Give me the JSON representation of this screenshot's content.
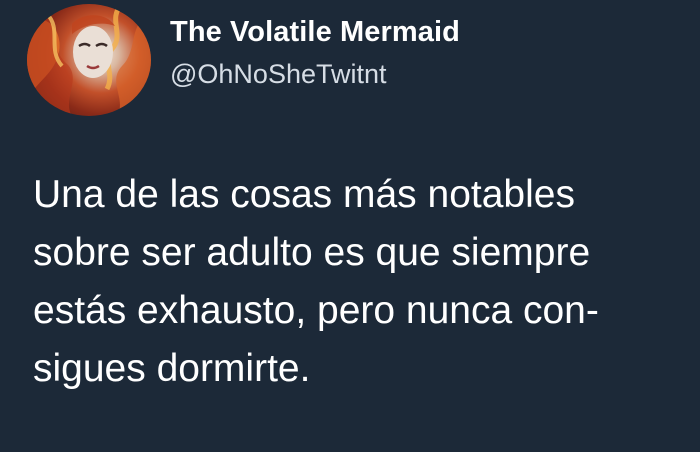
{
  "tweet": {
    "author": {
      "display_name": "The Volatile Mermaid",
      "handle": "@OhNoSheTwitnt"
    },
    "text_lines": [
      "Una de las cosas más notables",
      "sobre ser adulto es que siempre",
      "estás exhausto, pero nunca con-",
      "sigues dormirte."
    ]
  },
  "colors": {
    "background": "#1c2938",
    "text": "#ffffff",
    "handle": "#d6dde5"
  },
  "icons": {
    "avatar": "profile-avatar-image"
  }
}
